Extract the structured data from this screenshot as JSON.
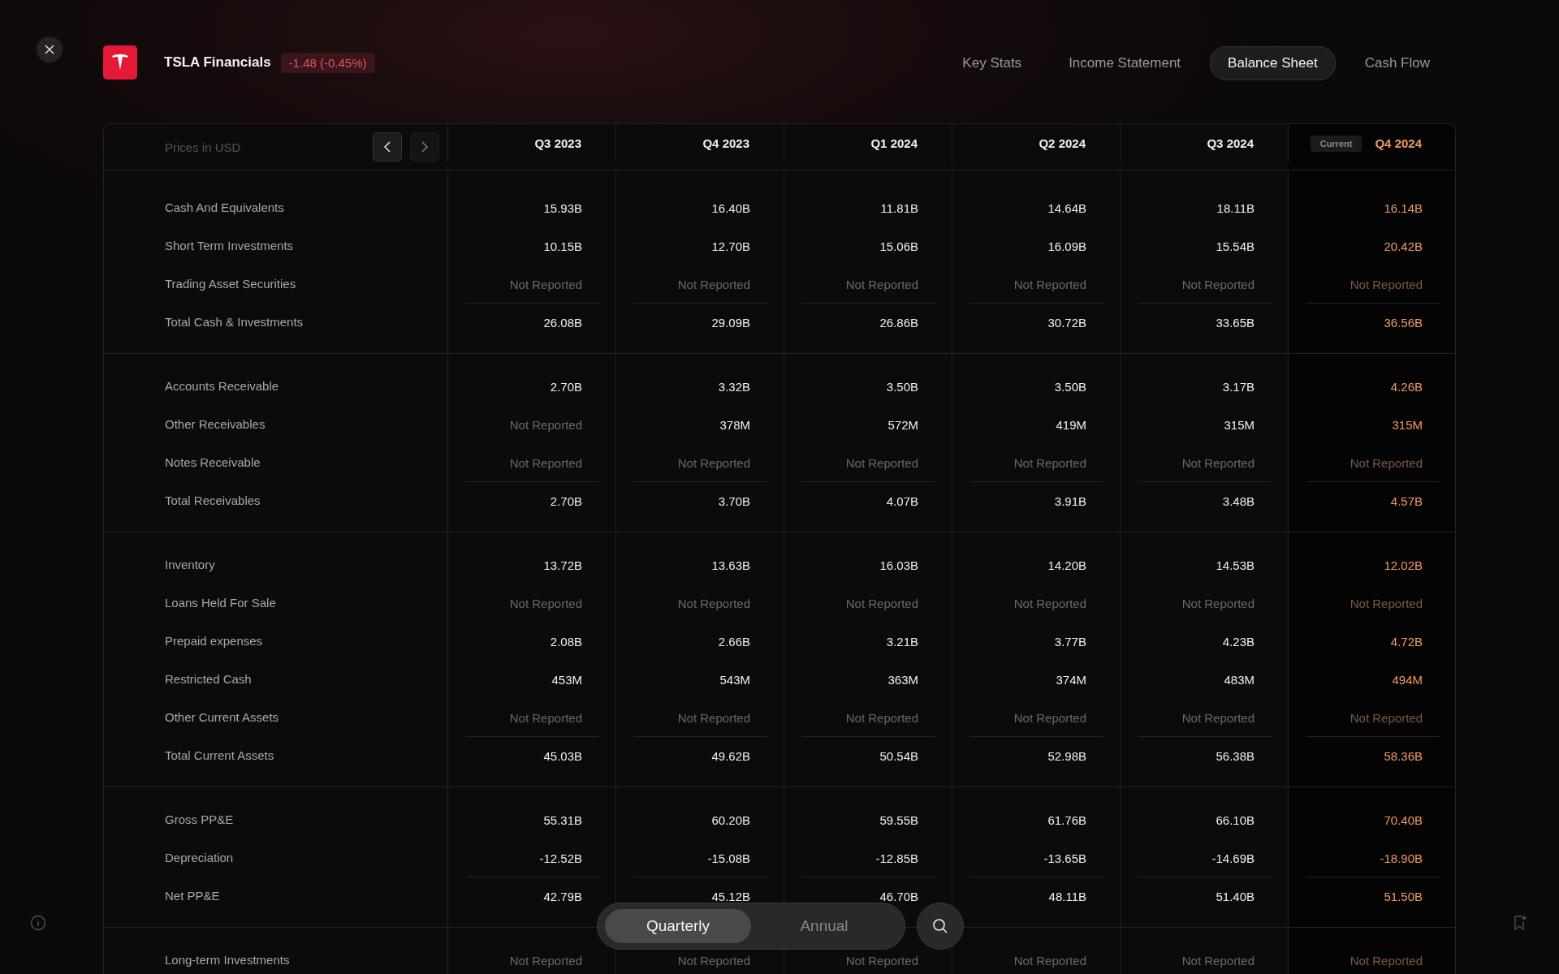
{
  "header": {
    "title": "TSLA Financials",
    "change": "-1.48 (-0.45%)"
  },
  "tabs": [
    {
      "label": "Key Stats",
      "selected": false
    },
    {
      "label": "Income Statement",
      "selected": false
    },
    {
      "label": "Balance Sheet",
      "selected": true
    },
    {
      "label": "Cash Flow",
      "selected": false
    }
  ],
  "table": {
    "caption": "Prices in USD",
    "nav": [
      {
        "kind": "prev",
        "disabled": false
      },
      {
        "kind": "next",
        "disabled": true
      }
    ],
    "columns": [
      {
        "label": "Q3 2023",
        "current": false
      },
      {
        "label": "Q4 2023",
        "current": false
      },
      {
        "label": "Q1 2024",
        "current": false
      },
      {
        "label": "Q2 2024",
        "current": false
      },
      {
        "label": "Q3 2024",
        "current": false
      },
      {
        "label": "Q4 2024",
        "current": true,
        "badge": "Current"
      }
    ],
    "groups": [
      {
        "rows": [
          {
            "label": "Cash And Equivalents",
            "total": false,
            "cells": [
              {
                "value": "15.93B",
                "reported": true
              },
              {
                "value": "16.40B",
                "reported": true
              },
              {
                "value": "11.81B",
                "reported": true
              },
              {
                "value": "14.64B",
                "reported": true
              },
              {
                "value": "18.11B",
                "reported": true
              },
              {
                "value": "16.14B",
                "reported": true
              }
            ]
          },
          {
            "label": "Short Term Investments",
            "total": false,
            "cells": [
              {
                "value": "10.15B",
                "reported": true
              },
              {
                "value": "12.70B",
                "reported": true
              },
              {
                "value": "15.06B",
                "reported": true
              },
              {
                "value": "16.09B",
                "reported": true
              },
              {
                "value": "15.54B",
                "reported": true
              },
              {
                "value": "20.42B",
                "reported": true
              }
            ]
          },
          {
            "label": "Trading Asset Securities",
            "total": false,
            "cells": [
              {
                "value": "Not Reported",
                "reported": false
              },
              {
                "value": "Not Reported",
                "reported": false
              },
              {
                "value": "Not Reported",
                "reported": false
              },
              {
                "value": "Not Reported",
                "reported": false
              },
              {
                "value": "Not Reported",
                "reported": false
              },
              {
                "value": "Not Reported",
                "reported": false
              }
            ]
          },
          {
            "label": "Total Cash & Investments",
            "total": true,
            "cells": [
              {
                "value": "26.08B",
                "reported": true
              },
              {
                "value": "29.09B",
                "reported": true
              },
              {
                "value": "26.86B",
                "reported": true
              },
              {
                "value": "30.72B",
                "reported": true
              },
              {
                "value": "33.65B",
                "reported": true
              },
              {
                "value": "36.56B",
                "reported": true
              }
            ]
          }
        ]
      },
      {
        "rows": [
          {
            "label": "Accounts Receivable",
            "total": false,
            "cells": [
              {
                "value": "2.70B",
                "reported": true
              },
              {
                "value": "3.32B",
                "reported": true
              },
              {
                "value": "3.50B",
                "reported": true
              },
              {
                "value": "3.50B",
                "reported": true
              },
              {
                "value": "3.17B",
                "reported": true
              },
              {
                "value": "4.26B",
                "reported": true
              }
            ]
          },
          {
            "label": "Other Receivables",
            "total": false,
            "cells": [
              {
                "value": "Not Reported",
                "reported": false
              },
              {
                "value": "378M",
                "reported": true
              },
              {
                "value": "572M",
                "reported": true
              },
              {
                "value": "419M",
                "reported": true
              },
              {
                "value": "315M",
                "reported": true
              },
              {
                "value": "315M",
                "reported": true
              }
            ]
          },
          {
            "label": "Notes Receivable",
            "total": false,
            "cells": [
              {
                "value": "Not Reported",
                "reported": false
              },
              {
                "value": "Not Reported",
                "reported": false
              },
              {
                "value": "Not Reported",
                "reported": false
              },
              {
                "value": "Not Reported",
                "reported": false
              },
              {
                "value": "Not Reported",
                "reported": false
              },
              {
                "value": "Not Reported",
                "reported": false
              }
            ]
          },
          {
            "label": "Total Receivables",
            "total": true,
            "cells": [
              {
                "value": "2.70B",
                "reported": true
              },
              {
                "value": "3.70B",
                "reported": true
              },
              {
                "value": "4.07B",
                "reported": true
              },
              {
                "value": "3.91B",
                "reported": true
              },
              {
                "value": "3.48B",
                "reported": true
              },
              {
                "value": "4.57B",
                "reported": true
              }
            ]
          }
        ]
      },
      {
        "rows": [
          {
            "label": "Inventory",
            "total": false,
            "cells": [
              {
                "value": "13.72B",
                "reported": true
              },
              {
                "value": "13.63B",
                "reported": true
              },
              {
                "value": "16.03B",
                "reported": true
              },
              {
                "value": "14.20B",
                "reported": true
              },
              {
                "value": "14.53B",
                "reported": true
              },
              {
                "value": "12.02B",
                "reported": true
              }
            ]
          },
          {
            "label": "Loans Held For Sale",
            "total": false,
            "cells": [
              {
                "value": "Not Reported",
                "reported": false
              },
              {
                "value": "Not Reported",
                "reported": false
              },
              {
                "value": "Not Reported",
                "reported": false
              },
              {
                "value": "Not Reported",
                "reported": false
              },
              {
                "value": "Not Reported",
                "reported": false
              },
              {
                "value": "Not Reported",
                "reported": false
              }
            ]
          },
          {
            "label": "Prepaid expenses",
            "total": false,
            "cells": [
              {
                "value": "2.08B",
                "reported": true
              },
              {
                "value": "2.66B",
                "reported": true
              },
              {
                "value": "3.21B",
                "reported": true
              },
              {
                "value": "3.77B",
                "reported": true
              },
              {
                "value": "4.23B",
                "reported": true
              },
              {
                "value": "4.72B",
                "reported": true
              }
            ]
          },
          {
            "label": "Restricted Cash",
            "total": false,
            "cells": [
              {
                "value": "453M",
                "reported": true
              },
              {
                "value": "543M",
                "reported": true
              },
              {
                "value": "363M",
                "reported": true
              },
              {
                "value": "374M",
                "reported": true
              },
              {
                "value": "483M",
                "reported": true
              },
              {
                "value": "494M",
                "reported": true
              }
            ]
          },
          {
            "label": "Other Current Assets",
            "total": false,
            "cells": [
              {
                "value": "Not Reported",
                "reported": false
              },
              {
                "value": "Not Reported",
                "reported": false
              },
              {
                "value": "Not Reported",
                "reported": false
              },
              {
                "value": "Not Reported",
                "reported": false
              },
              {
                "value": "Not Reported",
                "reported": false
              },
              {
                "value": "Not Reported",
                "reported": false
              }
            ]
          },
          {
            "label": "Total Current Assets",
            "total": true,
            "cells": [
              {
                "value": "45.03B",
                "reported": true
              },
              {
                "value": "49.62B",
                "reported": true
              },
              {
                "value": "50.54B",
                "reported": true
              },
              {
                "value": "52.98B",
                "reported": true
              },
              {
                "value": "56.38B",
                "reported": true
              },
              {
                "value": "58.36B",
                "reported": true
              }
            ]
          }
        ]
      },
      {
        "rows": [
          {
            "label": "Gross PP&E",
            "total": false,
            "cells": [
              {
                "value": "55.31B",
                "reported": true
              },
              {
                "value": "60.20B",
                "reported": true
              },
              {
                "value": "59.55B",
                "reported": true
              },
              {
                "value": "61.76B",
                "reported": true
              },
              {
                "value": "66.10B",
                "reported": true
              },
              {
                "value": "70.40B",
                "reported": true
              }
            ]
          },
          {
            "label": "Depreciation",
            "total": false,
            "cells": [
              {
                "value": "-12.52B",
                "reported": true
              },
              {
                "value": "-15.08B",
                "reported": true
              },
              {
                "value": "-12.85B",
                "reported": true
              },
              {
                "value": "-13.65B",
                "reported": true
              },
              {
                "value": "-14.69B",
                "reported": true
              },
              {
                "value": "-18.90B",
                "reported": true
              }
            ]
          },
          {
            "label": "Net PP&E",
            "total": true,
            "cells": [
              {
                "value": "42.79B",
                "reported": true
              },
              {
                "value": "45.12B",
                "reported": true
              },
              {
                "value": "46.70B",
                "reported": true
              },
              {
                "value": "48.11B",
                "reported": true
              },
              {
                "value": "51.40B",
                "reported": true
              },
              {
                "value": "51.50B",
                "reported": true
              }
            ]
          }
        ]
      },
      {
        "rows": [
          {
            "label": "Long-term Investments",
            "total": false,
            "cells": [
              {
                "value": "Not Reported",
                "reported": false
              },
              {
                "value": "Not Reported",
                "reported": false
              },
              {
                "value": "Not Reported",
                "reported": false
              },
              {
                "value": "Not Reported",
                "reported": false
              },
              {
                "value": "Not Reported",
                "reported": false
              },
              {
                "value": "Not Reported",
                "reported": false
              }
            ]
          }
        ]
      }
    ]
  },
  "period": [
    {
      "label": "Quarterly",
      "selected": true
    },
    {
      "label": "Annual",
      "selected": false
    }
  ]
}
